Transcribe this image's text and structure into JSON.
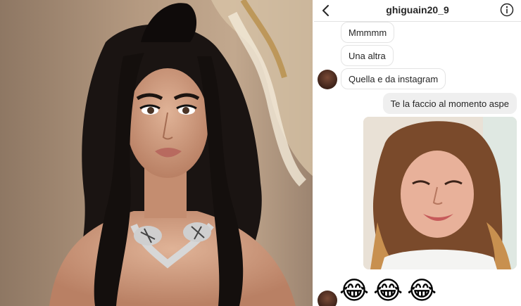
{
  "chat": {
    "username": "ghiguain20_9",
    "messages": [
      {
        "from": "other",
        "text": "Mmmmm"
      },
      {
        "from": "other",
        "text": "Una altra"
      },
      {
        "from": "other",
        "text": "Quella e da instagram"
      },
      {
        "from": "me",
        "text": "Te la faccio al momento aspe"
      },
      {
        "from": "me",
        "type": "photo"
      },
      {
        "from": "other",
        "type": "emoji",
        "text": [
          "😂",
          "😂",
          "😂"
        ]
      }
    ]
  },
  "icons": {
    "back": "chevron-left-icon",
    "info": "info-circle-icon"
  },
  "colors": {
    "sent_bubble": "#efefef",
    "received_border": "#e4e4e4",
    "text": "#262626"
  }
}
